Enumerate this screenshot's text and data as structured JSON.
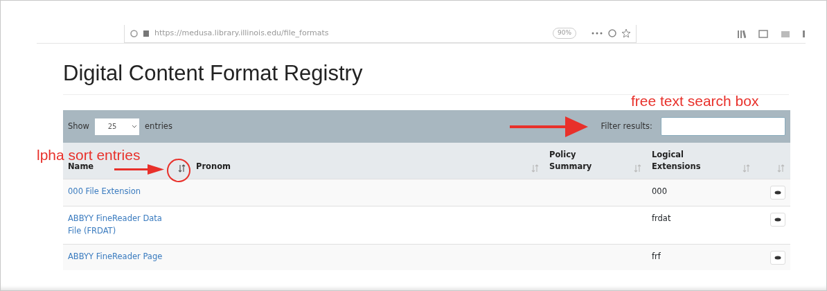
{
  "browser": {
    "url": "https://medusa.library.illinois.edu/file_formats",
    "zoom": "90%"
  },
  "page": {
    "title": "Digital Content Format Registry"
  },
  "toolbar": {
    "show_label": "Show",
    "page_size": "25",
    "entries_label": "entries",
    "filter_label": "Filter results:"
  },
  "table": {
    "columns": [
      {
        "label": "Name",
        "sorted": true
      },
      {
        "label": "Pronom",
        "sorted": false
      },
      {
        "label": "Policy Summary",
        "sorted": false
      },
      {
        "label": "Logical Extensions",
        "sorted": false
      },
      {
        "sorted": false
      }
    ],
    "rows": [
      {
        "name": "000 File Extension",
        "extensions": "000"
      },
      {
        "name": "ABBYY FineReader Data File (FRDAT)",
        "extensions": "frdat"
      },
      {
        "name": "ABBYY FineReader Page",
        "extensions": "frf"
      }
    ]
  },
  "annotations": [
    {
      "text": "free text search box"
    },
    {
      "text": "lpha sort entries"
    }
  ]
}
